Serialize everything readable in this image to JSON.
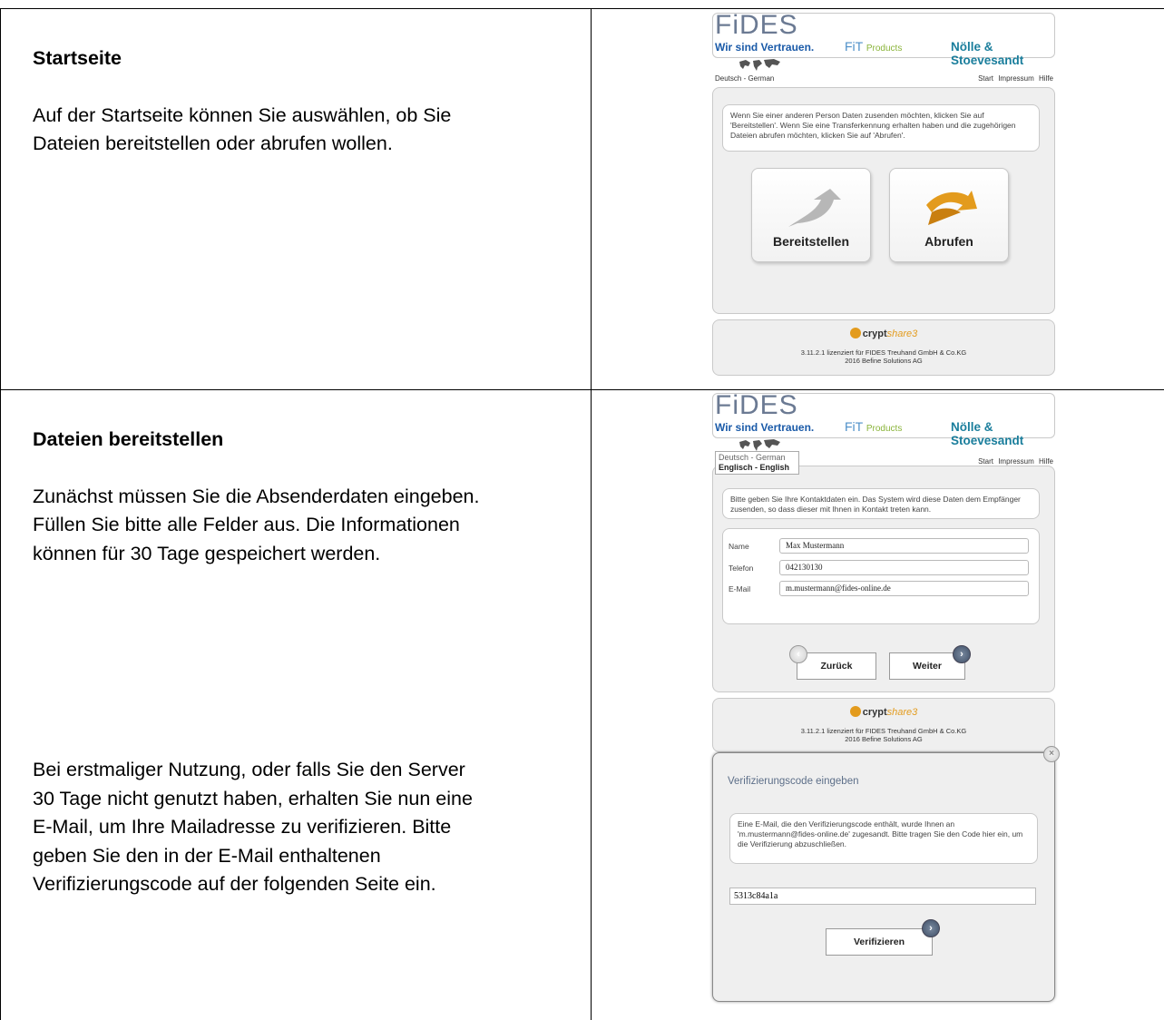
{
  "sections": [
    {
      "heading": "Startseite",
      "paragraph1_l1": "Auf der Startseite können Sie auswählen, ob Sie",
      "paragraph1_l2": "Dateien bereitstellen oder abrufen wollen."
    },
    {
      "heading": "Dateien bereitstellen",
      "p1_l1": "Zunächst müssen Sie die Absenderdaten eingeben.",
      "p1_l2": "Füllen Sie bitte alle Felder aus. Die Informationen",
      "p1_l3": "können für 30 Tage gespeichert werden.",
      "p2_l1": "Bei erstmaliger Nutzung, oder falls Sie den Server",
      "p2_l2": "30 Tage nicht genutzt haben, erhalten Sie nun eine",
      "p2_l3": "E-Mail, um Ihre Mailadresse zu verifizieren. Bitte",
      "p2_l4": "geben Sie den in der E-Mail enthaltenen",
      "p2_l5": "Verifizierungscode auf der folgenden Seite ein."
    }
  ],
  "branding": {
    "fides": "FiDES",
    "slogan": "Wir sind Vertrauen.",
    "fit": "FiT",
    "products": "Products",
    "noelle": "Nölle & Stoevesandt"
  },
  "nav": {
    "lang_current": "Deutsch - German",
    "lang_other": "Englisch - English",
    "top_links": "Start Impressum Hilfe"
  },
  "start_page": {
    "info": "Wenn Sie einer anderen Person Daten zusenden möchten, klicken Sie auf 'Bereitstellen'. Wenn Sie eine Transferkennung erhalten haben und die zugehörigen Dateien abrufen möchten, klicken Sie auf 'Abrufen'.",
    "btn_provide": "Bereitstellen",
    "btn_retrieve": "Abrufen"
  },
  "footer": {
    "logo_crypt": "crypt",
    "logo_share": "share3",
    "line1": "3.11.2.1 lizenziert für FIDES Treuhand GmbH & Co.KG",
    "line2": "2016 Befine Solutions AG"
  },
  "sender_page": {
    "info": "Bitte geben Sie Ihre Kontaktdaten ein. Das System wird diese Daten dem Empfänger zusenden, so dass dieser mit Ihnen in Kontakt treten kann.",
    "name_label": "Name",
    "name_value": "Max Mustermann",
    "phone_label": "Telefon",
    "phone_value": "042130130",
    "email_label": "E-Mail",
    "email_value": "m.mustermann@fides-online.de",
    "back": "Zurück",
    "next": "Weiter"
  },
  "verify_dialog": {
    "title": "Verifizierungscode eingeben",
    "info": "Eine E-Mail, die den Verifizierungscode enthält, wurde Ihnen an 'm.mustermann@fides-online.de' zugesandt. Bitte tragen Sie den Code hier ein, um die Verifizierung abzuschließen.",
    "code": "5313c84a1a",
    "button": "Verifizieren"
  },
  "colors": {
    "fides_blue": "#1a5aa8",
    "accent_orange": "#e39b1d",
    "panel_gray": "#efefef"
  }
}
